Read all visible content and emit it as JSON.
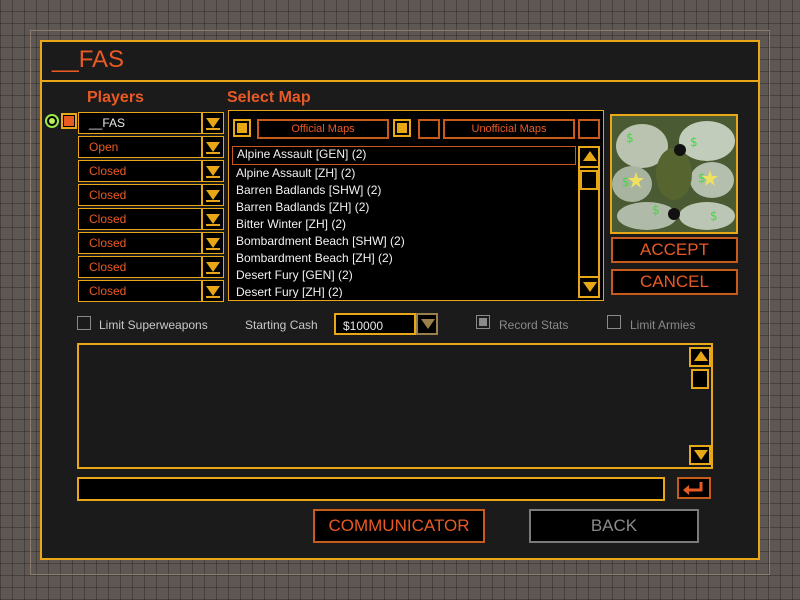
{
  "window": {
    "title": "__FAS"
  },
  "players": {
    "header": "Players",
    "slots": [
      {
        "label": "__FAS"
      },
      {
        "label": "Open"
      },
      {
        "label": "Closed"
      },
      {
        "label": "Closed"
      },
      {
        "label": "Closed"
      },
      {
        "label": "Closed"
      },
      {
        "label": "Closed"
      },
      {
        "label": "Closed"
      }
    ]
  },
  "select_map": {
    "header": "Select Map",
    "official_label": "Official Maps",
    "unofficial_label": "Unofficial Maps",
    "maps": [
      "Alpine Assault [GEN] (2)",
      "Alpine Assault [ZH] (2)",
      "Barren Badlands [SHW] (2)",
      "Barren Badlands [ZH] (2)",
      "Bitter Winter [ZH] (2)",
      "Bombardment Beach [SHW] (2)",
      "Bombardment Beach [ZH] (2)",
      "Desert Fury [GEN] (2)",
      "Desert Fury [ZH] (2)"
    ]
  },
  "buttons": {
    "accept": "ACCEPT",
    "cancel": "CANCEL",
    "communicator": "COMMUNICATOR",
    "back": "BACK"
  },
  "options": {
    "limit_superweapons": "Limit Superweapons",
    "starting_cash_label": "Starting Cash",
    "starting_cash_value": "$10000",
    "record_stats": "Record Stats",
    "limit_armies": "Limit Armies"
  },
  "colors": {
    "accent": "#e8a717",
    "text_orange": "#e85a24",
    "panel_bg": "#1b1b1b"
  }
}
